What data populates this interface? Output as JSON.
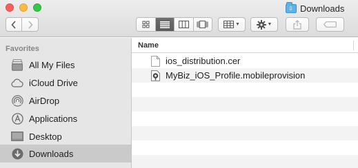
{
  "window": {
    "title": "Downloads"
  },
  "toolbar": {
    "back_icon": "chevron-left-icon",
    "forward_icon": "chevron-right-icon",
    "view_modes": [
      "icon-view",
      "list-view",
      "column-view",
      "cover-flow-view"
    ],
    "active_view": "list-view",
    "arrange_icon": "arrange-grid-icon",
    "action_icon": "gear-icon",
    "share_icon": "share-icon",
    "tags_icon": "tag-icon"
  },
  "sidebar": {
    "heading": "Favorites",
    "items": [
      {
        "label": "All My Files",
        "icon": "all-files-icon"
      },
      {
        "label": "iCloud Drive",
        "icon": "cloud-icon"
      },
      {
        "label": "AirDrop",
        "icon": "airdrop-icon"
      },
      {
        "label": "Applications",
        "icon": "applications-icon"
      },
      {
        "label": "Desktop",
        "icon": "desktop-icon"
      },
      {
        "label": "Downloads",
        "icon": "downloads-icon",
        "selected": true
      }
    ]
  },
  "list": {
    "column_name": "Name",
    "files": [
      {
        "name": "ios_distribution.cer",
        "icon": "document-icon"
      },
      {
        "name": "MyBiz_iOS_Profile.mobileprovision",
        "icon": "provisioning-profile-icon"
      }
    ]
  },
  "colors": {
    "sidebar_bg": "#e6e6e6",
    "selected_bg": "#cacaca",
    "folder_blue": "#5fb1ea",
    "close": "#fc605c",
    "minimize": "#fdbc40",
    "zoom": "#34c84a"
  }
}
